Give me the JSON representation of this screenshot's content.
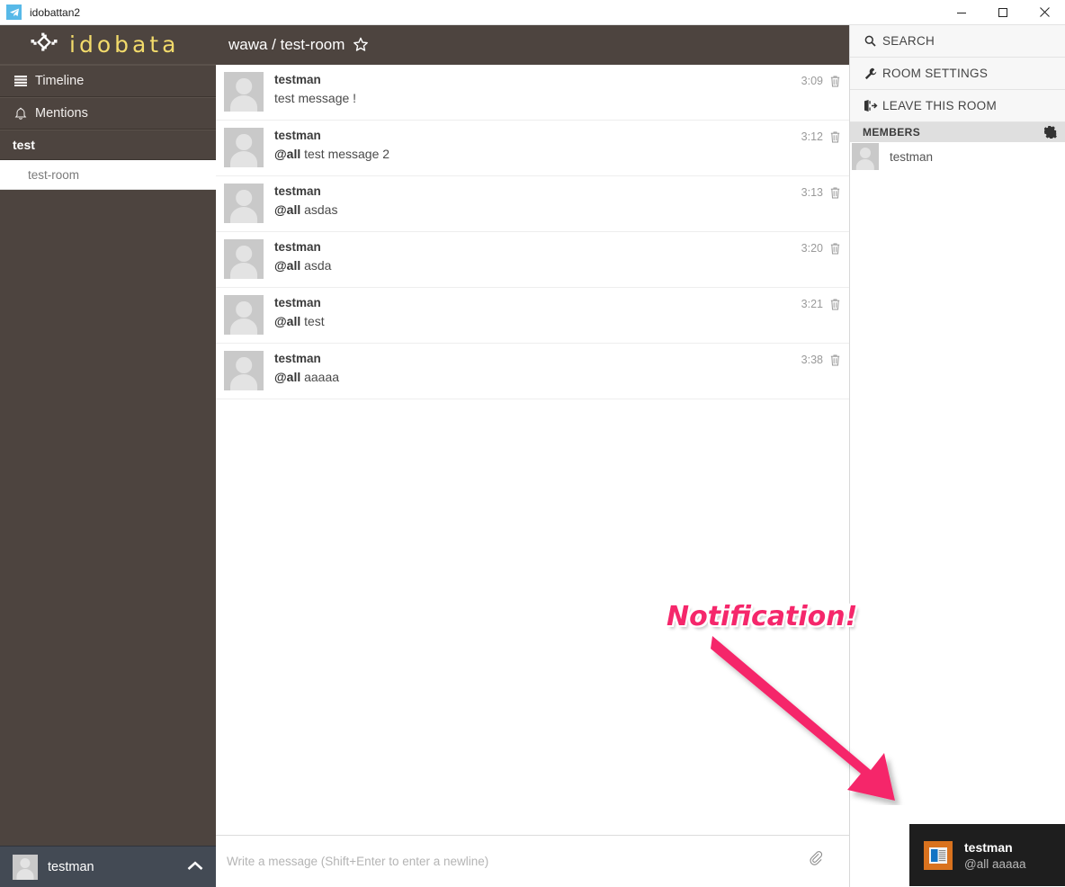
{
  "window": {
    "title": "idobattan2",
    "app_icon": "paper-plane-icon",
    "minimize_label": "—",
    "maximize_label": "□",
    "close_label": "✕"
  },
  "brand": {
    "name": "idobata",
    "mark": "diamond-logo-icon"
  },
  "sidebar": {
    "nav": [
      {
        "label": "Timeline",
        "icon": "list-icon"
      },
      {
        "label": "Mentions",
        "icon": "bell-icon"
      }
    ],
    "group": {
      "label": "test"
    },
    "rooms": [
      {
        "label": "test-room",
        "active": true
      }
    ],
    "user": {
      "name": "testman",
      "chevron": "chevron-up-icon"
    }
  },
  "room": {
    "organization": "wawa",
    "separator": "/",
    "name": "test-room",
    "title": "wawa / test-room",
    "star_icon": "star-outline-icon"
  },
  "messages": [
    {
      "author": "testman",
      "mention": "",
      "text": "test message !",
      "time": "3:09",
      "delete_icon": "trash-icon"
    },
    {
      "author": "testman",
      "mention": "@all",
      "text": "test message 2",
      "time": "3:12",
      "delete_icon": "trash-icon"
    },
    {
      "author": "testman",
      "mention": "@all",
      "text": "asdas",
      "time": "3:13",
      "delete_icon": "trash-icon"
    },
    {
      "author": "testman",
      "mention": "@all",
      "text": "asda",
      "time": "3:20",
      "delete_icon": "trash-icon"
    },
    {
      "author": "testman",
      "mention": "@all",
      "text": "test",
      "time": "3:21",
      "delete_icon": "trash-icon"
    },
    {
      "author": "testman",
      "mention": "@all",
      "text": "aaaaa",
      "time": "3:38",
      "delete_icon": "trash-icon"
    }
  ],
  "composer": {
    "value": "",
    "placeholder": "Write a message (Shift+Enter to enter a newline)",
    "attach_icon": "paperclip-icon"
  },
  "right_panel": {
    "actions": [
      {
        "label": "SEARCH",
        "icon": "search-icon"
      },
      {
        "label": "ROOM SETTINGS",
        "icon": "wrench-icon"
      },
      {
        "label": "LEAVE THIS ROOM",
        "icon": "exit-icon"
      }
    ],
    "members_header": {
      "label": "MEMBERS",
      "icon": "gear-icon"
    },
    "members": [
      {
        "name": "testman"
      }
    ]
  },
  "annotation": {
    "text": "Notification!",
    "color": "#f5276b",
    "arrow_icon": "arrow-down-right-icon"
  },
  "toast": {
    "icon": "app-window-icon",
    "icon_bg": "#d9721e",
    "title": "testman",
    "subtitle": "@all aaaaa"
  },
  "colors": {
    "sidebar_bg": "#4d443f",
    "brand_yellow": "#f3db6b",
    "user_bar_bg": "#434a54",
    "accent_pink": "#f5276b",
    "toast_bg": "#1e1e1e"
  }
}
